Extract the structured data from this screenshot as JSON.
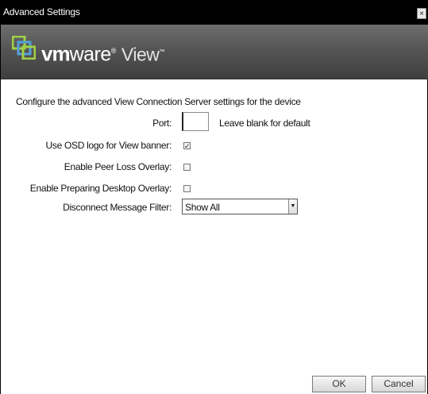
{
  "window": {
    "title": "Advanced Settings",
    "close_glyph": "×"
  },
  "banner": {
    "logo_icon": "vmware-logo-icon",
    "brand_vm": "vm",
    "brand_ware": "ware",
    "brand_reg": "®",
    "product": "View",
    "tm": "™"
  },
  "form": {
    "description": "Configure the advanced View Connection Server settings for the device",
    "port": {
      "label": "Port:",
      "value": "",
      "hint": "Leave blank for default"
    },
    "osd_logo": {
      "label": "Use OSD logo for View banner:",
      "checked": true,
      "mark": "✓"
    },
    "peer_loss": {
      "label": "Enable Peer Loss Overlay:",
      "checked": false
    },
    "preparing_desktop": {
      "label": "Enable Preparing Desktop Overlay:",
      "checked": false
    },
    "disconnect_filter": {
      "label": "Disconnect Message Filter:",
      "selected": "Show All",
      "arrow": "▼"
    }
  },
  "buttons": {
    "ok": "OK",
    "cancel": "Cancel"
  },
  "colors": {
    "titlebar": "#000000",
    "banner": "#555555",
    "background": "#ffffff"
  }
}
